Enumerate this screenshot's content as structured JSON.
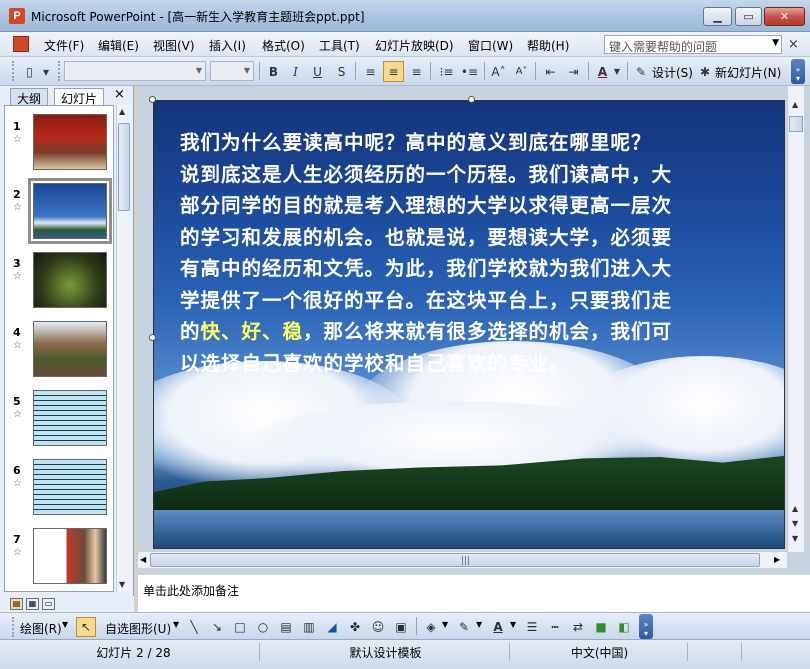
{
  "window": {
    "title": "Microsoft PowerPoint - [高一新生入学教育主题班会ppt.ppt]",
    "app_icon": "powerpoint-icon"
  },
  "menu": {
    "items": [
      "文件(F)",
      "编辑(E)",
      "视图(V)",
      "插入(I)",
      "格式(O)",
      "工具(T)",
      "幻灯片放映(D)",
      "窗口(W)",
      "帮助(H)"
    ],
    "help_placeholder": "键入需要帮助的问题"
  },
  "toolbar": {
    "design_label": "设计(S)",
    "new_slide_label": "新幻灯片(N)",
    "font_name": "",
    "font_size": ""
  },
  "left_pane": {
    "tab_outline": "大纲",
    "tab_slides": "幻灯片",
    "close": "×",
    "thumbnails": [
      {
        "num": "1"
      },
      {
        "num": "2",
        "selected": true
      },
      {
        "num": "3"
      },
      {
        "num": "4"
      },
      {
        "num": "5"
      },
      {
        "num": "6"
      },
      {
        "num": "7"
      }
    ]
  },
  "slide": {
    "lines": [
      "我们为什么要读高中呢？高中的意义到底在哪里呢？",
      "说到底这是人生必须经历的一个历程。我们读高中，大",
      "部分同学的目的就是考入理想的大学以求得更高一层次",
      "的学习和发展的机会。也就是说，要想读大学，必须要",
      "有高中的经历和文凭。为此，我们学校就为我们进入大",
      "学提供了一个很好的平台。在这块平台上，只要我们走"
    ],
    "line7_pre": "的",
    "line7_hl": "快、好、稳",
    "line7_post": "，那么将来就有很多选择的机会，我们可",
    "line8": "以选择自己喜欢的学校和自己喜欢的专业。",
    "highlight_color": "#ffff66"
  },
  "notes": {
    "placeholder": "单击此处添加备注"
  },
  "drawing": {
    "draw_label": "绘图(R)",
    "autoshapes_label": "自选图形(U)"
  },
  "status": {
    "slide_pos": "幻灯片 2 / 28",
    "template": "默认设计模板",
    "language": "中文(中国)"
  }
}
